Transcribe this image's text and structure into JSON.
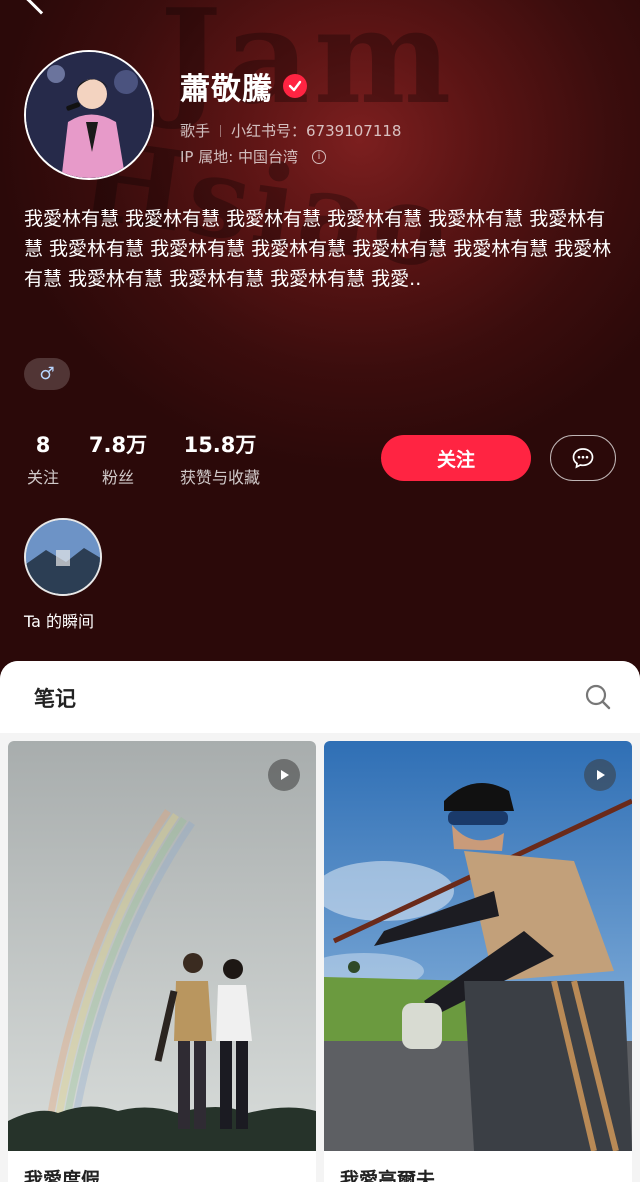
{
  "profile": {
    "name": "蕭敬騰",
    "role": "歌手",
    "xhs_id": "小红书号：6739107118",
    "ip_location": "IP 属地: 中国台湾",
    "bio": "我愛林有慧 我愛林有慧 我愛林有慧 我愛林有慧 我愛林有慧 我愛林有慧 我愛林有慧 我愛林有慧 我愛林有慧 我愛林有慧 我愛林有慧 我愛林有慧 我愛林有慧 我愛林有慧 我愛林有慧 我愛..",
    "gender_symbol": "♂",
    "header_watermark": "Jam Hsiao"
  },
  "stats": [
    {
      "num": "8",
      "label": "关注"
    },
    {
      "num": "7.8万",
      "label": "粉丝"
    },
    {
      "num": "15.8万",
      "label": "获赞与收藏"
    }
  ],
  "actions": {
    "follow_label": "关注"
  },
  "moments": {
    "label": "Ta 的瞬间"
  },
  "notes": {
    "tab_label": "笔记",
    "cards": [
      {
        "title": "我愛度假",
        "is_video": true
      },
      {
        "title": "我愛高爾夫",
        "is_video": true
      }
    ]
  },
  "colors": {
    "accent": "#ff2442",
    "header_bg": "#5a1414",
    "sheet_bg": "#f4f4f4"
  },
  "icons": [
    "back-chevron-icon",
    "verified-icon",
    "info-icon",
    "gender-male-icon",
    "message-icon",
    "search-icon",
    "play-icon"
  ]
}
